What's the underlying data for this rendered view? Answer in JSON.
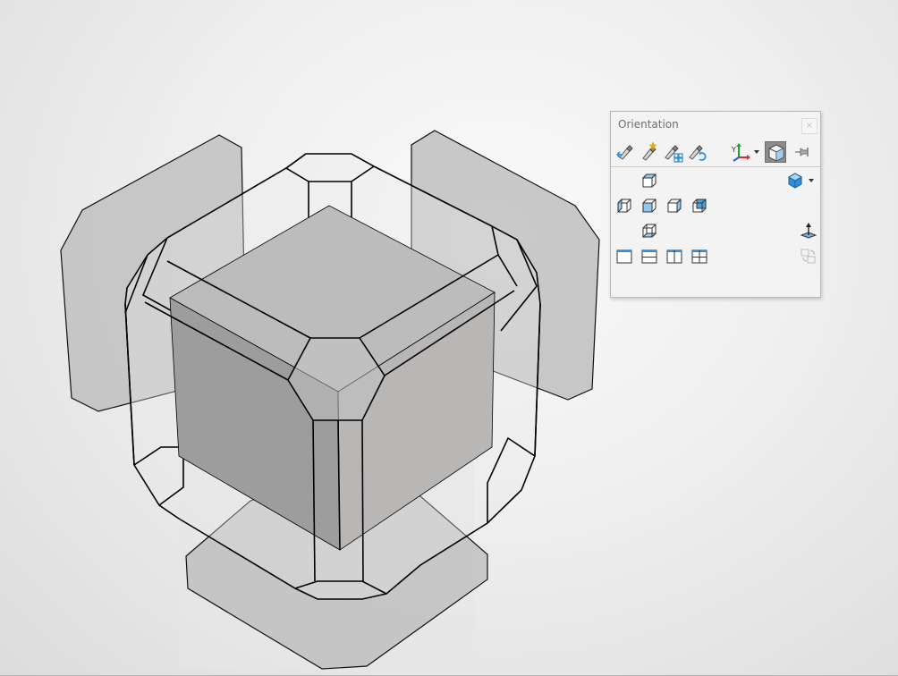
{
  "window": {
    "panel_title": "Orientation",
    "close_glyph": "×"
  },
  "toolbar": {
    "icons": [
      "previous-view-icon",
      "new-view-icon",
      "update-standard-views-icon",
      "reset-standard-views-icon",
      "triad-axes-icon",
      "axes-dropdown-icon",
      "view-selector-icon",
      "pin-icon"
    ],
    "active_icon": "view-selector-icon"
  },
  "views": {
    "icons": [
      "top-view-icon",
      "left-view-icon",
      "front-view-icon",
      "right-view-icon",
      "back-view-icon",
      "bottom-view-icon",
      "single-view-icon",
      "two-view-horizontal-icon",
      "two-view-vertical-icon",
      "four-view-icon",
      "isometric-view-icon",
      "isometric-dropdown-icon",
      "normal-to-icon",
      "link-views-icon"
    ]
  },
  "colors": {
    "accent_blue": "#2f8fd8",
    "active_button": "#8c8c8c",
    "panel_background": "#f3f3f3"
  }
}
